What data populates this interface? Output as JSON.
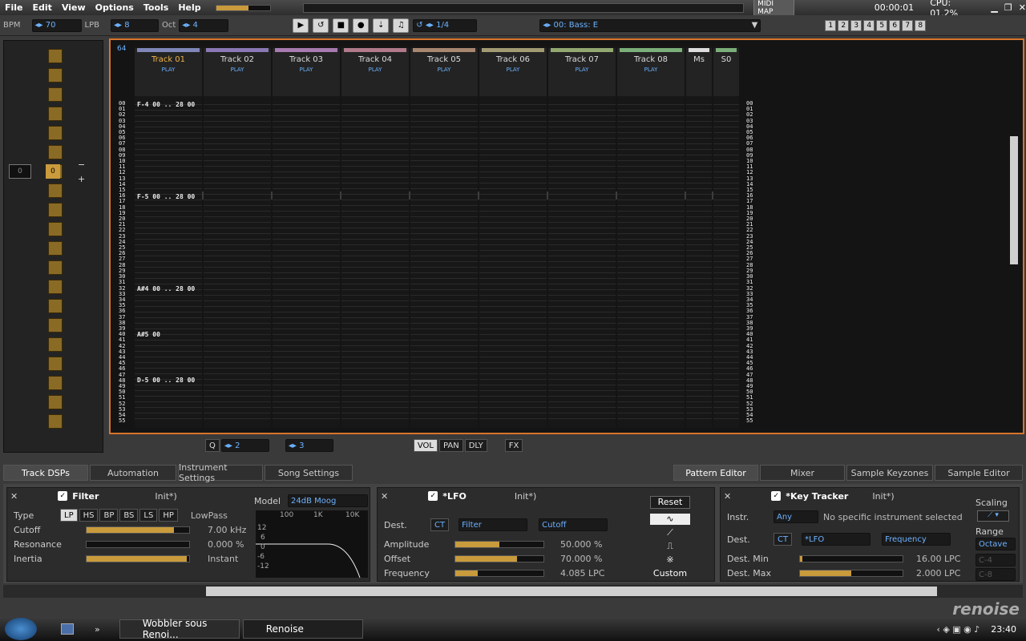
{
  "menu": {
    "items": [
      "File",
      "Edit",
      "View",
      "Options",
      "Tools",
      "Help"
    ],
    "midi_map": "MIDI MAP",
    "time": "00:00:01",
    "cpu": "CPU: 01.2%"
  },
  "toolbar": {
    "bpm_label": "BPM",
    "bpm": "70",
    "lpb_label": "LPB",
    "lpb": "8",
    "oct_label": "Oct",
    "oct": "4",
    "step": "1/4",
    "instrument": "00: Bass: E",
    "page_numbers": [
      "1",
      "2",
      "3",
      "4",
      "5",
      "6",
      "7",
      "8"
    ]
  },
  "left": {
    "value1": "0",
    "value2": "0"
  },
  "pattern": {
    "length": "64",
    "tracks": [
      {
        "name": "Track 01",
        "color": "#7f86b8"
      },
      {
        "name": "Track 02",
        "color": "#8a78b4"
      },
      {
        "name": "Track 03",
        "color": "#a77ab0"
      },
      {
        "name": "Track 04",
        "color": "#b07a8a"
      },
      {
        "name": "Track 05",
        "color": "#a88770"
      },
      {
        "name": "Track 06",
        "color": "#a29a72"
      },
      {
        "name": "Track 07",
        "color": "#93a871"
      },
      {
        "name": "Track 08",
        "color": "#7bae78"
      }
    ],
    "master": "Ms",
    "send": "S0",
    "play_label": "PLAY",
    "notes": [
      {
        "row": 0,
        "text": "F-4 00 .. 28 00"
      },
      {
        "row": 16,
        "text": "F-5 00 .. 28 00"
      },
      {
        "row": 32,
        "text": "A#4 00 .. 28 00"
      },
      {
        "row": 40,
        "text": "A#5 00"
      },
      {
        "row": 48,
        "text": "D-5 00 .. 28 00"
      }
    ]
  },
  "pattern_tools": {
    "q_label": "Q",
    "q_value": "2",
    "step_value": "3",
    "vol": "VOL",
    "pan": "PAN",
    "dly": "DLY",
    "fx": "FX"
  },
  "tabs": {
    "left": [
      "Track DSPs",
      "Automation",
      "Instrument Settings",
      "Song Settings"
    ],
    "right": [
      "Pattern Editor",
      "Mixer",
      "Sample Keyzones",
      "Sample Editor"
    ]
  },
  "filter": {
    "title": "Filter",
    "preset": "Init*)",
    "model_label": "Model",
    "model": "24dB Moog",
    "type_label": "Type",
    "types": [
      "LP",
      "HS",
      "BP",
      "BS",
      "LS",
      "HP"
    ],
    "type_value": "LowPass",
    "cutoff_label": "Cutoff",
    "cutoff_value": "7.00 kHz",
    "cutoff": 0.85,
    "resonance_label": "Resonance",
    "resonance_value": "0.000 %",
    "resonance": 0,
    "inertia_label": "Inertia",
    "inertia_value": "Instant",
    "inertia": 0.98,
    "freq_ticks": [
      "100",
      "1K",
      "10K"
    ],
    "db_ticks": [
      "12",
      "6",
      "0",
      "-6",
      "-12"
    ]
  },
  "lfo": {
    "title": "*LFO",
    "preset": "Init*)",
    "dest_label": "Dest.",
    "dest_ct": "CT",
    "dest_device": "Filter",
    "dest_param": "Cutoff",
    "amplitude_label": "Amplitude",
    "amplitude_value": "50.000 %",
    "amplitude": 0.5,
    "offset_label": "Offset",
    "offset_value": "70.000 %",
    "offset": 0.7,
    "frequency_label": "Frequency",
    "frequency_value": "4.085 LPC",
    "frequency": 0.25,
    "reset": "Reset",
    "custom": "Custom"
  },
  "keytracker": {
    "title": "*Key Tracker",
    "preset": "Init*)",
    "instr_label": "Instr.",
    "instr": "Any",
    "instr_note": "No specific instrument selected",
    "dest_label": "Dest.",
    "dest_ct": "CT",
    "dest_device": "*LFO",
    "dest_param": "Frequency",
    "dest_min_label": "Dest. Min",
    "dest_min_value": "16.00 LPC",
    "dest_min": 0.02,
    "dest_max_label": "Dest. Max",
    "dest_max_value": "2.000 LPC",
    "dest_max": 0.5,
    "scaling_label": "Scaling",
    "range_label": "Range",
    "range": "Octave",
    "range_low": "C-4",
    "range_high": "C-8"
  },
  "brand": "renoise",
  "taskbar": {
    "tasks": [
      "Wobbler sous Renoi...",
      "Renoise"
    ],
    "clock": "23:40"
  }
}
